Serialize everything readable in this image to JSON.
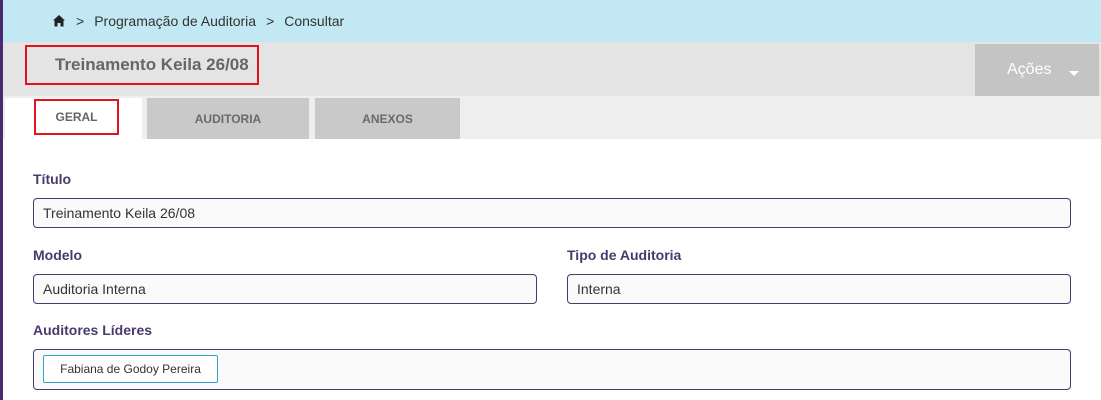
{
  "breadcrumb": {
    "items": [
      "Programação de Auditoria",
      "Consultar"
    ],
    "separator": ">"
  },
  "header": {
    "title": "Treinamento Keila 26/08",
    "actions_label": "Ações"
  },
  "tabs": [
    {
      "label": "GERAL",
      "active": true
    },
    {
      "label": "AUDITORIA",
      "active": false
    },
    {
      "label": "ANEXOS",
      "active": false
    }
  ],
  "form": {
    "titulo": {
      "label": "Título",
      "value": "Treinamento Keila 26/08"
    },
    "modelo": {
      "label": "Modelo",
      "value": "Auditoria Interna"
    },
    "tipo": {
      "label": "Tipo de Auditoria",
      "value": "Interna"
    },
    "auditores": {
      "label": "Auditores Líderes",
      "values": [
        "Fabiana de Godoy Pereira"
      ]
    }
  },
  "colors": {
    "breadcrumb_bg": "#c2e9f3",
    "highlight_border": "#e3141b",
    "label_color": "#4a3a6b",
    "chip_border": "#2aa8c8"
  },
  "icons": {
    "home": "home-icon",
    "actions_caret": "chevron-down-icon"
  }
}
